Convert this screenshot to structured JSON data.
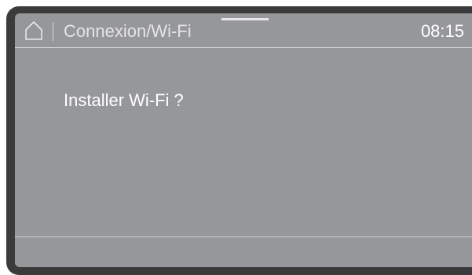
{
  "header": {
    "title": "Connexion/Wi-Fi",
    "time": "08:15",
    "home_icon": "home-icon"
  },
  "main": {
    "question": "Installer Wi-Fi ?"
  },
  "colors": {
    "screen_background": "#96979a",
    "bezel": "#3b3b3b",
    "text": "#ffffff"
  }
}
